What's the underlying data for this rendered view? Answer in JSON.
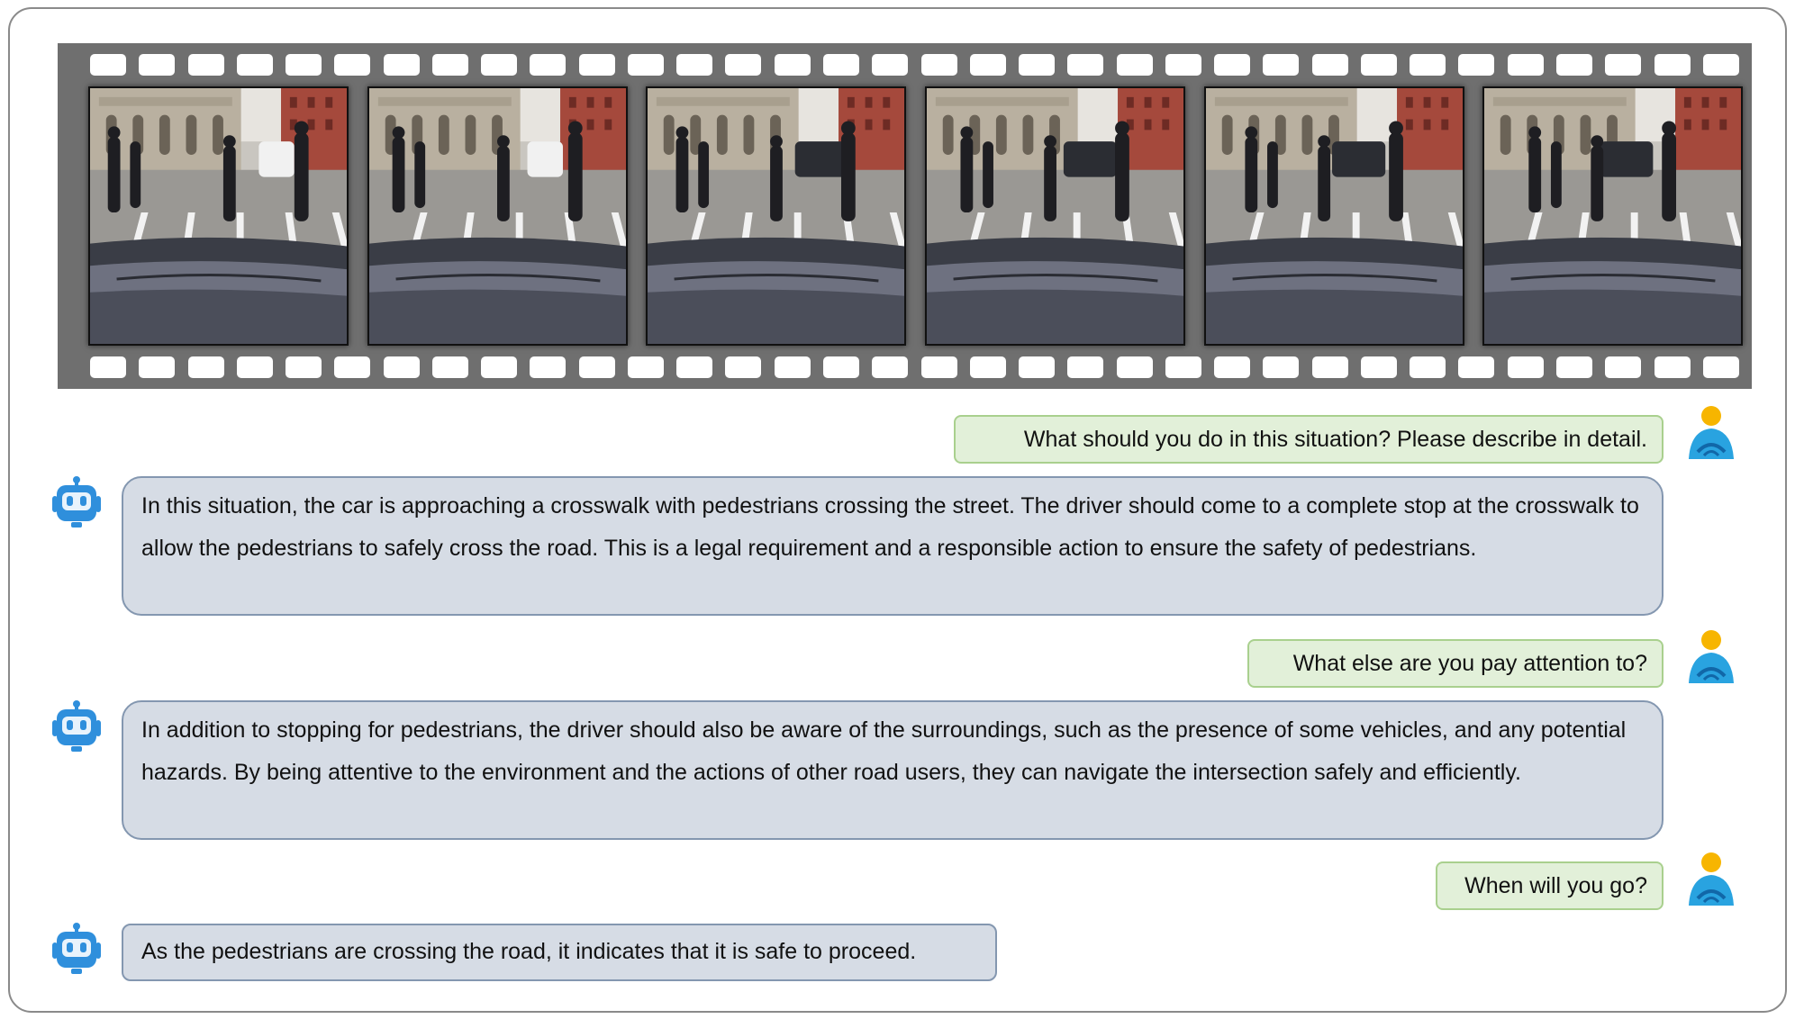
{
  "film_strip": {
    "frame_count": 6,
    "frames": [
      {
        "label": "frame-1"
      },
      {
        "label": "frame-2"
      },
      {
        "label": "frame-3"
      },
      {
        "label": "frame-4"
      },
      {
        "label": "frame-5"
      },
      {
        "label": "frame-6"
      }
    ],
    "colors": {
      "strip": "#6f6f6f",
      "hole": "#ffffff"
    }
  },
  "conversation": [
    {
      "role": "user",
      "text": "What should you do in this situation? Please  describe in detail."
    },
    {
      "role": "assistant",
      "text": "In this situation, the car is approaching a crosswalk with pedestrians crossing the street. The driver should come to a complete stop at the crosswalk to allow the pedestrians to safely cross the road. This is a legal requirement and a responsible action to ensure the safety of pedestrians."
    },
    {
      "role": "user",
      "text": "What else are you pay attention to?"
    },
    {
      "role": "assistant",
      "text": "In addition to stopping for pedestrians, the driver should also be aware of the surroundings, such as the presence of some vehicles, and any potential hazards. By being attentive to the environment and the actions of other road users, they can navigate the intersection safely and efficiently."
    },
    {
      "role": "user",
      "text": "When will you go?"
    },
    {
      "role": "assistant",
      "text": "As the pedestrians are crossing the road, it indicates that it is safe to proceed."
    }
  ],
  "icons": {
    "user": "user-avatar-icon",
    "assistant": "robot-icon"
  },
  "colors": {
    "user_bubble_bg": "#e2f0d9",
    "user_bubble_border": "#a9d08e",
    "bot_bubble_bg": "#d6dce5",
    "bot_bubble_border": "#8497b0",
    "avatar_head": "#f7b500",
    "avatar_body": "#29a3e0",
    "robot": "#2f8fdc"
  }
}
